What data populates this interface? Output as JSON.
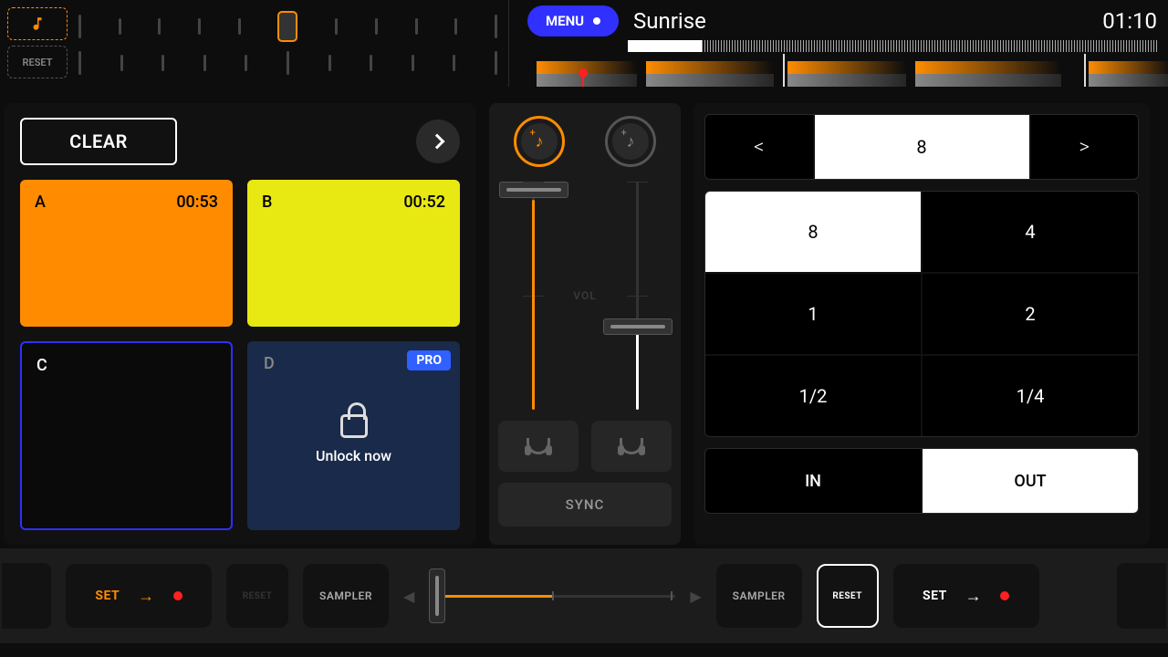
{
  "topbar": {
    "reset_label": "RESET"
  },
  "track": {
    "menu_label": "MENU",
    "title": "Sunrise",
    "time": "01:10"
  },
  "left": {
    "clear_label": "CLEAR",
    "pads": {
      "a": {
        "label": "A",
        "time": "00:53"
      },
      "b": {
        "label": "B",
        "time": "00:52"
      },
      "c": {
        "label": "C"
      },
      "d": {
        "label": "D",
        "pro": "PRO",
        "unlock": "Unlock now"
      }
    }
  },
  "center": {
    "vol_label": "VOL",
    "sync_label": "SYNC"
  },
  "right": {
    "loop": {
      "prev": "<",
      "value": "8",
      "next": ">"
    },
    "beats": [
      "8",
      "4",
      "1",
      "2",
      "1/2",
      "1/4"
    ],
    "in_label": "IN",
    "out_label": "OUT"
  },
  "bottom": {
    "set_label": "SET",
    "reset_label": "RESET",
    "sampler_label": "SAMPLER"
  }
}
